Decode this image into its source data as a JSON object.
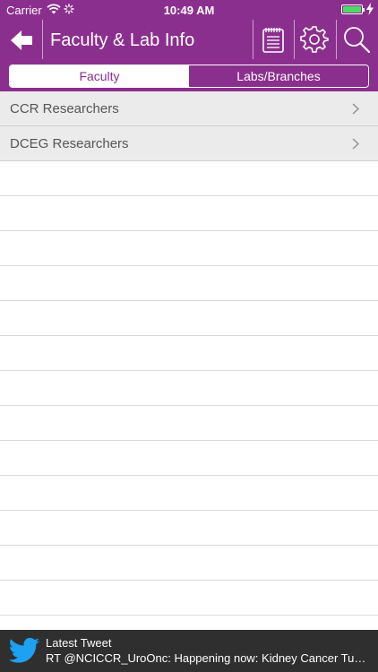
{
  "status_bar": {
    "carrier": "Carrier",
    "time": "10:49 AM"
  },
  "header": {
    "title": "Faculty & Lab Info",
    "icons": [
      "back-arrow-icon",
      "notepad-icon",
      "gear-icon",
      "search-icon"
    ]
  },
  "tabs": [
    {
      "label": "Faculty",
      "active": true
    },
    {
      "label": "Labs/Branches",
      "active": false
    }
  ],
  "list": {
    "items": [
      {
        "label": "CCR Researchers"
      },
      {
        "label": "DCEG Researchers"
      }
    ]
  },
  "footer": {
    "title": "Latest Tweet",
    "text": "RT @NCICCR_UroOnc: Happening now: Kidney Cancer Tumor Board"
  },
  "colors": {
    "brand_purple": "#8b2f8e",
    "row_fill": "#ebebeb",
    "footer_bg": "#2f2f2f",
    "twitter_blue": "#1da1f2"
  }
}
